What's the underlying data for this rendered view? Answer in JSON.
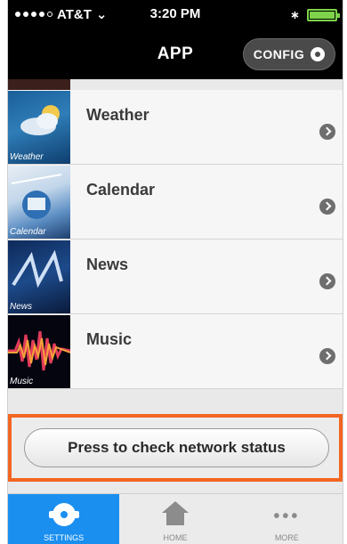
{
  "status_bar": {
    "carrier": "AT&T",
    "time": "3:20 PM"
  },
  "nav": {
    "title": "APP",
    "config_label": "CONFIG"
  },
  "list": {
    "items": [
      {
        "label": "Weather",
        "thumb_label": "Weather"
      },
      {
        "label": "Calendar",
        "thumb_label": "Calendar"
      },
      {
        "label": "News",
        "thumb_label": "News"
      },
      {
        "label": "Music",
        "thumb_label": "Music"
      }
    ]
  },
  "network": {
    "button_label": "Press to check network status",
    "highlight_color": "#f26522"
  },
  "tab_bar": {
    "tabs": [
      {
        "label": "SETTINGS",
        "icon": "gear-icon",
        "active": true
      },
      {
        "label": "HOME",
        "icon": "home-icon",
        "active": false
      },
      {
        "label": "MORE",
        "icon": "more-icon",
        "active": false
      }
    ],
    "active_color": "#1a8ff0"
  }
}
